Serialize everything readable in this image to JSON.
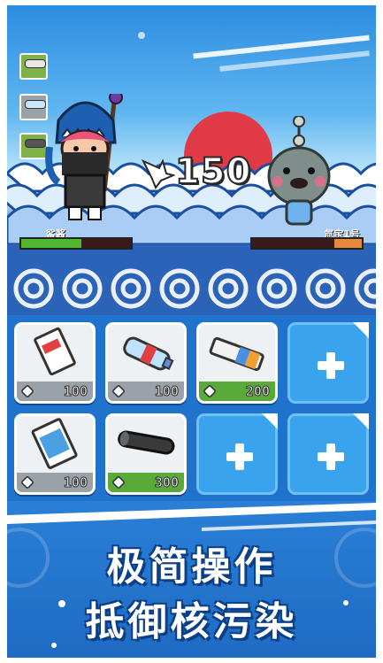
{
  "battle": {
    "damage": "150",
    "player": {
      "name": "鲨酱",
      "hp_fraction": 0.55,
      "hp_color": "#4fb830"
    },
    "enemy": {
      "name": "氚宝1号",
      "hp_fraction": 0.25,
      "hp_color": "#e58a3a"
    },
    "side_items": [
      {
        "icon": "battery-item-icon"
      },
      {
        "icon": "bottle-item-icon"
      },
      {
        "icon": "pipe-item-icon"
      }
    ]
  },
  "inventory": {
    "slots": [
      {
        "type": "item",
        "icon": "milk-carton-icon",
        "cost_icon": "eraser-icon",
        "cost": "100",
        "bar": "gray"
      },
      {
        "type": "item",
        "icon": "water-bottle-icon",
        "cost_icon": "leaf-icon",
        "cost": "100",
        "bar": "gray"
      },
      {
        "type": "item",
        "icon": "battery-icon",
        "cost_icon": "recycle-icon",
        "cost": "200",
        "bar": "green"
      },
      {
        "type": "empty",
        "icon": "add-slot-icon"
      },
      {
        "type": "item",
        "icon": "juice-box-icon",
        "cost_icon": "eraser-icon",
        "cost": "100",
        "bar": "gray"
      },
      {
        "type": "item",
        "icon": "pipe-icon",
        "cost_icon": "gear-icon",
        "cost": "300",
        "bar": "green"
      },
      {
        "type": "empty",
        "icon": "add-slot-icon"
      },
      {
        "type": "empty",
        "icon": "add-slot-icon"
      }
    ]
  },
  "slogan": {
    "line1": "极简操作",
    "line2": "抵御核污染"
  },
  "colors": {
    "sun": "#e03a47",
    "panel_blue": "#1f73cc",
    "empty_slot": "#3aa3ee",
    "price_gray": "#9aa1a8",
    "price_green": "#5aaa3a"
  }
}
